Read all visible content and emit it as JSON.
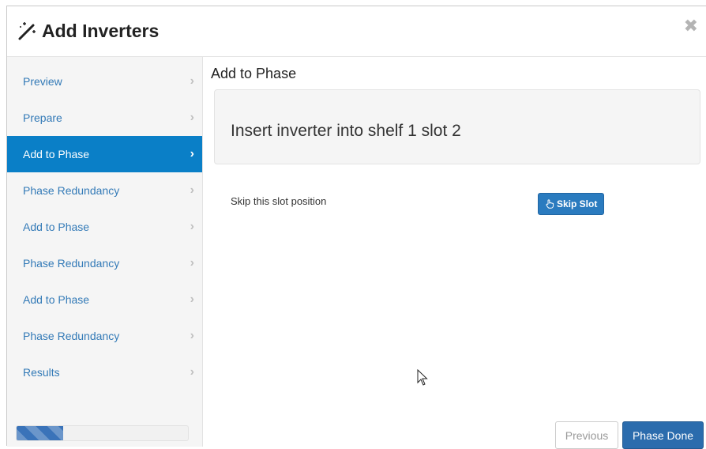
{
  "dialog": {
    "title": "Add Inverters",
    "title_icon": "magic-wand-icon",
    "close_icon": "close-icon",
    "close_glyph": "✖"
  },
  "sidebar": {
    "chevron_glyph": "›",
    "items": [
      {
        "label": "Preview",
        "active": false
      },
      {
        "label": "Prepare",
        "active": false
      },
      {
        "label": "Add to Phase",
        "active": true
      },
      {
        "label": "Phase Redundancy",
        "active": false
      },
      {
        "label": "Add to Phase",
        "active": false
      },
      {
        "label": "Phase Redundancy",
        "active": false
      },
      {
        "label": "Add to Phase",
        "active": false
      },
      {
        "label": "Phase Redundancy",
        "active": false
      },
      {
        "label": "Results",
        "active": false
      }
    ],
    "progress_fraction": 0.27
  },
  "main": {
    "section_title": "Add to Phase",
    "instruction": "Insert inverter into shelf 1 slot 2",
    "skip_text": "Skip this slot position",
    "skip_button_label": "Skip Slot",
    "skip_button_icon": "hand-pointer-icon"
  },
  "footer": {
    "previous_label": "Previous",
    "done_label": "Phase Done"
  },
  "colors": {
    "accent": "#0a7fc7",
    "primary_button": "#2b6cad",
    "link": "#337ab7"
  }
}
